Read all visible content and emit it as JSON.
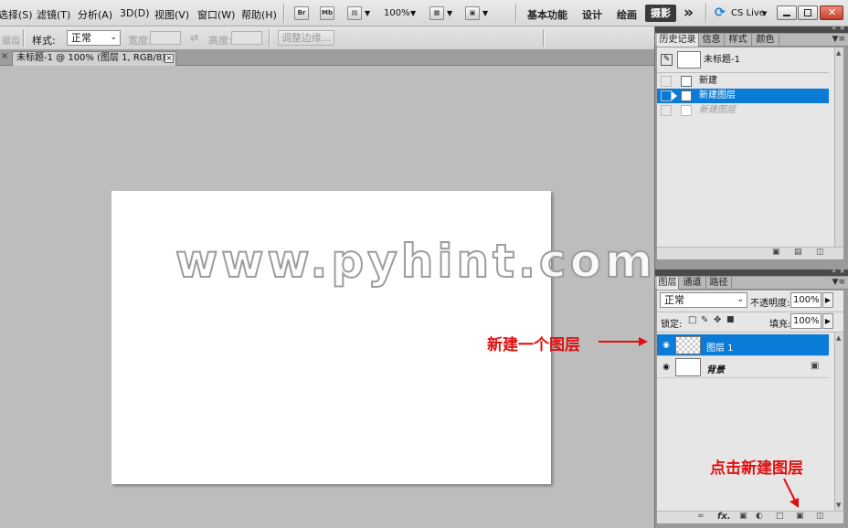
{
  "menubar": {
    "items": [
      "选择(S)",
      "滤镜(T)",
      "分析(A)",
      "3D(D)",
      "视图(V)",
      "窗口(W)",
      "帮助(H)"
    ],
    "br_label": "Br",
    "mb_label": "Mb",
    "zoom": "100%",
    "workspaces": [
      "基本功能",
      "设计",
      "绘画"
    ],
    "active_workspace": "摄影",
    "more": "»",
    "cs_live": "CS Live"
  },
  "optbar": {
    "cut_label": "锯齿",
    "style_label": "样式:",
    "style_value": "正常",
    "width_label": "宽度:",
    "height_label": "高度:",
    "refine_edge": "调整边缘..."
  },
  "document": {
    "tab_title": "未标题-1 @ 100% (图层 1, RGB/8) *",
    "watermark": "www.pyhint.com"
  },
  "history_panel": {
    "tabs": [
      "历史记录",
      "信息",
      "样式",
      "颜色"
    ],
    "snapshot": "未标题-1",
    "rows": [
      {
        "label": "新建",
        "selected": false,
        "dim": false
      },
      {
        "label": "新建图层",
        "selected": true,
        "dim": false
      },
      {
        "label": "新建图层",
        "selected": false,
        "dim": true
      }
    ]
  },
  "layers_panel": {
    "tabs": [
      "图层",
      "通道",
      "路径"
    ],
    "blend_mode": "正常",
    "opacity_label": "不透明度:",
    "opacity": "100%",
    "lock_label": "锁定:",
    "fill_label": "填充:",
    "fill": "100%",
    "layers": [
      {
        "name": "图层 1",
        "selected": true
      },
      {
        "name": "背景",
        "selected": false
      }
    ],
    "footer_fx": "fx."
  },
  "annotations": {
    "new_layer": "新建一个图层",
    "click_new_layer": "点击新建图层"
  },
  "colors": {
    "selection_blue": "#0a7bd6",
    "annotation_red": "#e01010"
  }
}
